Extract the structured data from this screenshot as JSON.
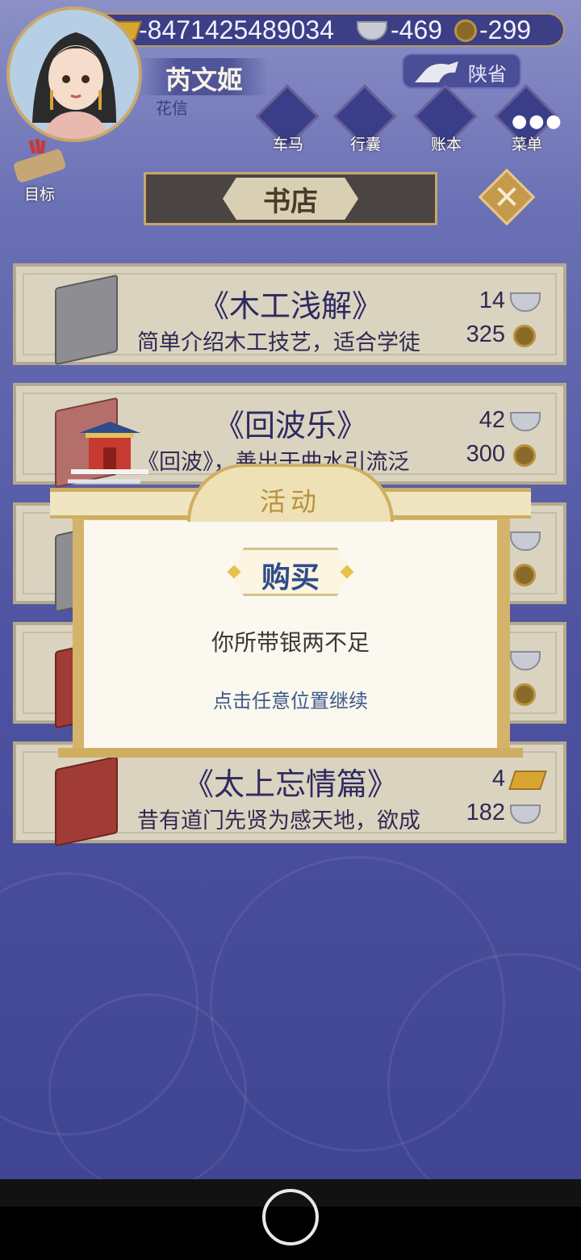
{
  "header": {
    "gold": "-8471425489034",
    "silver": "-469",
    "coins": "-299",
    "player_name": "芮文姬",
    "player_subtitle": "花信",
    "province": "陕省"
  },
  "nav": [
    {
      "label": "车马",
      "icon": "carriage-icon"
    },
    {
      "label": "行囊",
      "icon": "bag-icon"
    },
    {
      "label": "账本",
      "icon": "ledger-icon"
    },
    {
      "label": "菜单",
      "icon": "menu-dots-icon"
    }
  ],
  "goal": {
    "label": "目标"
  },
  "shop": {
    "title": "书店",
    "close_icon": "close-icon"
  },
  "books": [
    {
      "title": "《木工浅解》",
      "desc": "简单介绍木工技艺，适合学徒",
      "price1": "14",
      "price1_currency": "silver",
      "price2": "325",
      "price2_currency": "coin",
      "cover": "gray"
    },
    {
      "title": "《回波乐》",
      "desc": "《回波》，善出于曲水引流泛",
      "price1": "42",
      "price1_currency": "silver",
      "price2": "300",
      "price2_currency": "coin",
      "cover": "gray"
    },
    {
      "title": "《太上忘情篇》",
      "desc": "昔有道门先贤为感天地，欲成",
      "price1": "4",
      "price1_currency": "gold",
      "price2": "182",
      "price2_currency": "silver",
      "cover": "red"
    }
  ],
  "modal": {
    "header": "活动",
    "tag": "购买",
    "message": "你所带银两不足",
    "hint": "点击任意位置继续"
  },
  "colors": {
    "background": "#5a60aa",
    "panel": "#dad3c0",
    "modal_frame": "#d4b46a",
    "accent_text": "#2f4c8a"
  }
}
